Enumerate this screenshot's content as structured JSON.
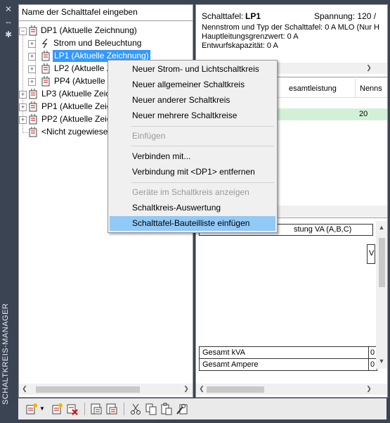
{
  "palette": {
    "title": "SCHALTKREIS-MANAGER",
    "icons": [
      "close-icon",
      "autohide-icon",
      "properties-icon"
    ]
  },
  "left": {
    "search_placeholder": "Name der Schalttafel eingeben",
    "tree": [
      {
        "label": "DP1 (Aktuelle Zeichnung)",
        "icon": "panel-icon",
        "expander": "-"
      },
      {
        "label": "Strom und Beleuchtung",
        "icon": "power-lightning-icon",
        "expander": "+"
      },
      {
        "label": "LP1 (Aktuelle Zeichnung)",
        "icon": "panel-icon",
        "expander": "+",
        "selected": true
      },
      {
        "label": "LP2 (Aktuelle Z",
        "icon": "panel-icon",
        "expander": "+"
      },
      {
        "label": "PP4 (Aktuelle Z",
        "icon": "panel-icon",
        "expander": "+"
      },
      {
        "label": "LP3 (Aktuelle Zeic",
        "icon": "panel-icon",
        "expander": "+"
      },
      {
        "label": "PP1 (Aktuelle Zeic",
        "icon": "panel-icon",
        "expander": "+"
      },
      {
        "label": "PP2 (Aktuelle Zeic",
        "icon": "panel-icon",
        "expander": "+"
      },
      {
        "label": "<Nicht zugewiese",
        "icon": "panel-icon",
        "expander": ""
      }
    ]
  },
  "right": {
    "panel_label": "Schalttafel:",
    "panel_name": "LP1",
    "voltage": "Spannung: 120 /",
    "lines": [
      "Nennstrom und Typ der Schalttafel: 0 A MLO (Nur H",
      "Hauptleitungsgrenzwert: 0 A",
      "Entwurfskapazität: 0 A"
    ],
    "grid1": {
      "headers": [
        "esamtleistung",
        "Nenns"
      ],
      "row_value": "20"
    },
    "grid2": {
      "header": "stung VA (A,B,C)",
      "side_value": "V",
      "totals": [
        {
          "label": "Gesamt kVA",
          "value": "0"
        },
        {
          "label": "Gesamt Ampere",
          "value": "0"
        }
      ]
    }
  },
  "menu": {
    "items": [
      {
        "label": "Neuer Strom- und Lichtschaltkreis",
        "enabled": true
      },
      {
        "label": "Neuer allgemeiner Schaltkreis",
        "enabled": true
      },
      {
        "label": "Neuer anderer Schaltkreis",
        "enabled": true
      },
      {
        "label": "Neuer mehrere Schaltkreise",
        "enabled": true
      },
      {
        "label": "Einfügen",
        "enabled": false
      },
      {
        "label": "Verbinden mit...",
        "enabled": true
      },
      {
        "label": "Verbindung mit <DP1> entfernen",
        "enabled": true
      },
      {
        "label": "Geräte im Schaltkreis anzeigen",
        "enabled": false
      },
      {
        "label": "Schaltkreis-Auswertung",
        "enabled": true
      },
      {
        "label": "Schalttafel-Bauteilliste einfügen",
        "enabled": true,
        "highlighted": true
      }
    ]
  },
  "toolbar": {
    "icons": [
      "new-circuit-icon",
      "dropdown-arrow-icon",
      "new-panel-icon",
      "delete-icon",
      "panel-schedule-icon",
      "panel-list-icon",
      "cut-icon",
      "copy-icon",
      "paste-icon",
      "properties-wrench-icon"
    ]
  },
  "colors": {
    "palette_bg": "#3b4453",
    "selection": "#3399ff",
    "menu_highlight": "#91c9f7",
    "grid_highlight": "#d2f0d8"
  }
}
